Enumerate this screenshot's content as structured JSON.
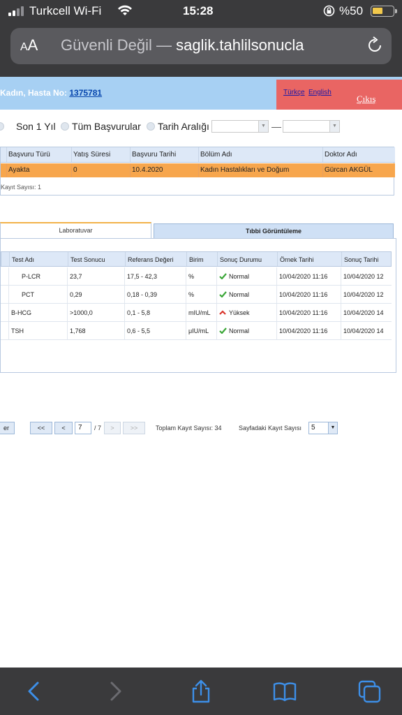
{
  "status_bar": {
    "carrier": "Turkcell Wi-Fi",
    "time": "15:28",
    "battery_percent": "%50",
    "battery_level": 0.5
  },
  "address_bar": {
    "aa_small": "A",
    "aa_large": "A",
    "security_text": "Güvenli Değil —",
    "domain": "saglik.tahlilsonucla"
  },
  "header": {
    "patient_text": "Kadın, Hasta No:",
    "patient_no": "1375781",
    "lang_tr": "Türkçe",
    "lang_en": "English",
    "logout": "Çıkış"
  },
  "filters": {
    "options": [
      "Son 1 Yıl",
      "Tüm Başvurular",
      "Tarih Aralığı"
    ],
    "separator": "—"
  },
  "applications": {
    "columns": [
      "Başvuru Türü",
      "Yatış Süresi",
      "Başvuru Tarihi",
      "Bölüm Adı",
      "Doktor Adı"
    ],
    "rows": [
      [
        "Ayakta",
        "0",
        "10.4.2020",
        "Kadın Hastalıkları ve Doğum",
        "Gürcan AKGÜL"
      ]
    ],
    "record_count": "Kayıt Sayısı: 1"
  },
  "tabs": {
    "active": "Laboratuvar",
    "inactive": "Tıbbi Görüntüleme"
  },
  "lab_results": {
    "columns": [
      "Test Adı",
      "Test Sonucu",
      "Referans Değeri",
      "Birim",
      "Sonuç Durumu",
      "Örnek Tarihi",
      "Sonuç Tarihi"
    ],
    "rows": [
      {
        "test": "P-LCR",
        "result": "23,7",
        "reference": "17,5 - 42,3",
        "unit": "%",
        "status": "Normal",
        "status_type": "normal",
        "sample_date": "10/04/2020 11:16",
        "result_date": "10/04/2020 12"
      },
      {
        "test": "PCT",
        "result": "0,29",
        "reference": "0,18 - 0,39",
        "unit": "%",
        "status": "Normal",
        "status_type": "normal",
        "sample_date": "10/04/2020 11:16",
        "result_date": "10/04/2020 12"
      },
      {
        "test": "B-HCG",
        "result": ">1000,0",
        "reference": "0,1 - 5,8",
        "unit": "mIU/mL",
        "status": "Yüksek",
        "status_type": "high",
        "sample_date": "10/04/2020 11:16",
        "result_date": "10/04/2020 14"
      },
      {
        "test": "TSH",
        "result": "1,768",
        "reference": "0,6 - 5,5",
        "unit": "μIU/mL",
        "status": "Normal",
        "status_type": "normal",
        "sample_date": "10/04/2020 11:16",
        "result_date": "10/04/2020 14"
      }
    ]
  },
  "pager": {
    "left_button": "er",
    "first": "<<",
    "prev": "<",
    "next": ">",
    "last": ">>",
    "current_page": "7",
    "total_pages": "/ 7",
    "total_records": "Toplam Kayıt Sayısı: 34",
    "page_size_label": "Sayfadaki Kayıt Sayısı",
    "page_size": "5"
  },
  "colors": {
    "chrome": "#3a3a3c",
    "header_band": "#a7d0f3",
    "logout_box": "#e96563",
    "selected_row": "#f7a64d",
    "table_header": "#dde8f7",
    "ok_green": "#3aa637",
    "high_red": "#d9342b",
    "ios_blue": "#3d8fe8"
  },
  "icons": [
    "signal-icon",
    "wifi-icon",
    "rotation-lock-icon",
    "battery-icon",
    "reload-icon",
    "check-icon",
    "arrow-up-icon",
    "back-icon",
    "forward-icon",
    "share-icon",
    "bookmarks-icon",
    "tabs-icon"
  ]
}
